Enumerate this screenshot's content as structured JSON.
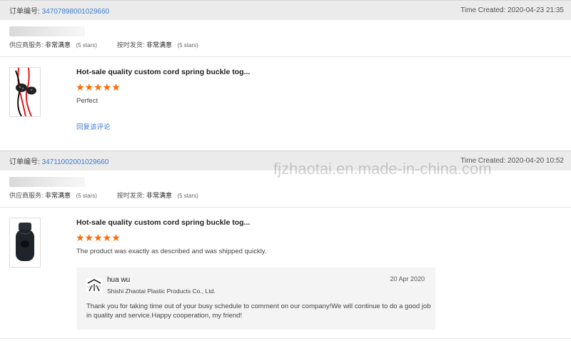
{
  "orders": [
    {
      "order_label": "订单编号:",
      "order_number": "34707898001029660",
      "time_created": "Time Created: 2020-04-23 21:35",
      "supplier_service_label": "供应商服务:",
      "supplier_service_value": "非常满意",
      "supplier_service_stars": "(5 stars)",
      "ontime_label": "按时发货:",
      "ontime_value": "非常满意",
      "ontime_stars": "(5 stars)",
      "product_title": "Hot-sale quality custom cord spring buckle tog...",
      "rating": 5,
      "comment": "Perfect",
      "reply_link": "回复该评论"
    },
    {
      "order_label": "订单编号:",
      "order_number": "34711002001029660",
      "time_created": "Time Created: 2020-04-20 10:52",
      "supplier_service_label": "供应商服务:",
      "supplier_service_value": "非常满意",
      "supplier_service_stars": "(5 stars)",
      "ontime_label": "按时发货:",
      "ontime_value": "非常满意",
      "ontime_stars": "(5 stars)",
      "product_title": "Hot-sale quality custom cord spring buckle tog...",
      "rating": 5,
      "comment": "The product was exactly as described and was shipped quickly.",
      "seller_reply": {
        "name": "hua wu",
        "company": "Shishi Zhaotai Plastic Products Co., Ltd.",
        "date": "20 Apr 2020",
        "text": "Thank you for taking time out of your busy schedule to comment on our company!We will continue to do a good job in quality and service.Happy cooperation, my friend!"
      }
    }
  ],
  "watermark": "fjzhaotai.en.made-in-china.com",
  "star_glyph": "★★★★★",
  "colors": {
    "accent_link": "#3a7dd2",
    "star": "#ff6a00",
    "header_bg": "#ebebeb"
  },
  "icons": {
    "product1": "cord-lock-red-cord-image",
    "product2": "cord-lock-black-image",
    "seller": "company-logo-icon"
  }
}
